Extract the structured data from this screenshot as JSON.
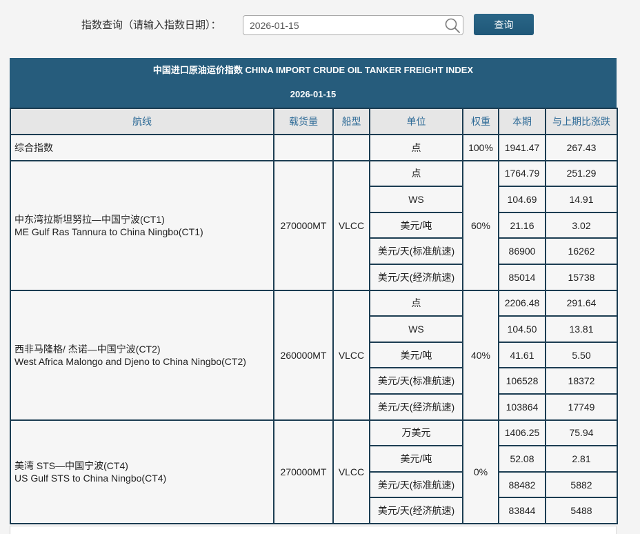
{
  "query_bar": {
    "label": "指数查询（请输入指数日期）：",
    "date_value": "2026-01-15",
    "search_icon": "search-icon",
    "submit_label": "查询"
  },
  "index_table": {
    "title": "中国进口原油运价指数 CHINA IMPORT CRUDE OIL TANKER FREIGHT INDEX",
    "date": "2026-01-15",
    "columns": [
      "航线",
      "载货量",
      "船型",
      "单位",
      "权重",
      "本期",
      "与上期比涨跌"
    ],
    "composite": {
      "route": "综合指数",
      "unit": "点",
      "weight": "100%",
      "current": "1941.47",
      "change": "267.43"
    },
    "routes": [
      {
        "name_zh": "中东湾拉斯坦努拉—中国宁波(CT1)",
        "name_en": "ME Gulf Ras Tannura to China Ningbo(CT1)",
        "cargo": "270000MT",
        "ship_type": "VLCC",
        "weight": "60%",
        "rows": [
          {
            "unit": "点",
            "current": "1764.79",
            "change": "251.29"
          },
          {
            "unit": "WS",
            "current": "104.69",
            "change": "14.91"
          },
          {
            "unit": "美元/吨",
            "current": "21.16",
            "change": "3.02"
          },
          {
            "unit": "美元/天(标准航速)",
            "current": "86900",
            "change": "16262"
          },
          {
            "unit": "美元/天(经济航速)",
            "current": "85014",
            "change": "15738"
          }
        ]
      },
      {
        "name_zh": "西非马隆格/ 杰诺—中国宁波(CT2)",
        "name_en": "West Africa Malongo and Djeno to China Ningbo(CT2)",
        "cargo": "260000MT",
        "ship_type": "VLCC",
        "weight": "40%",
        "rows": [
          {
            "unit": "点",
            "current": "2206.48",
            "change": "291.64"
          },
          {
            "unit": "WS",
            "current": "104.50",
            "change": "13.81"
          },
          {
            "unit": "美元/吨",
            "current": "41.61",
            "change": "5.50"
          },
          {
            "unit": "美元/天(标准航速)",
            "current": "106528",
            "change": "18372"
          },
          {
            "unit": "美元/天(经济航速)",
            "current": "103864",
            "change": "17749"
          }
        ]
      },
      {
        "name_zh": "美湾 STS—中国宁波(CT4)",
        "name_en": "US Gulf STS to China Ningbo(CT4)",
        "cargo": "270000MT",
        "ship_type": "VLCC",
        "weight": "0%",
        "rows": [
          {
            "unit": "万美元",
            "current": "1406.25",
            "change": "75.94"
          },
          {
            "unit": "美元/吨",
            "current": "52.08",
            "change": "2.81"
          },
          {
            "unit": "美元/天(标准航速)",
            "current": "88482",
            "change": "5882"
          },
          {
            "unit": "美元/天(经济航速)",
            "current": "83844",
            "change": "5488"
          }
        ]
      }
    ]
  },
  "colors": {
    "header_band": "#265c7c",
    "button": "#1f5778",
    "border": "#1c3d52",
    "column_header_bg": "#e6e6e6",
    "column_header_text": "#2e6b97",
    "cell_bg": "#f6f6f6",
    "page_bg": "#f4f4f4"
  }
}
